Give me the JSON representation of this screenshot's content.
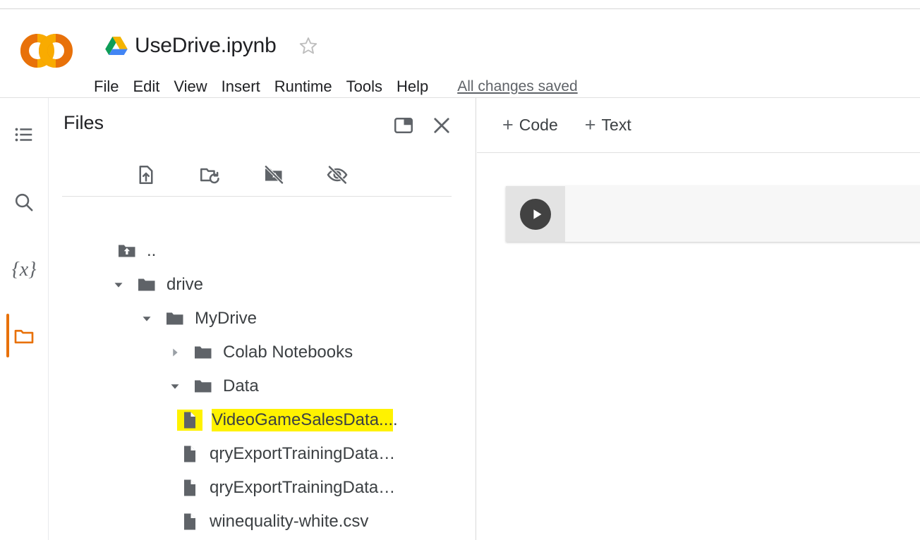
{
  "header": {
    "logo_name": "colab-logo",
    "drive_icon": "google-drive-icon",
    "doc_title": "UseDrive.ipynb",
    "star_icon": "star-outline-icon",
    "menus": [
      "File",
      "Edit",
      "View",
      "Insert",
      "Runtime",
      "Tools",
      "Help"
    ],
    "save_status": "All changes saved"
  },
  "rail": {
    "items": [
      {
        "name": "table-of-contents",
        "icon": "list-icon"
      },
      {
        "name": "find-and-replace",
        "icon": "search-icon"
      },
      {
        "name": "variables",
        "icon": "variables-icon",
        "label": "{x}"
      },
      {
        "name": "files",
        "icon": "folder-icon",
        "active": true
      }
    ]
  },
  "files_panel": {
    "title": "Files",
    "dock_button": "dock-panel-icon",
    "close_button": "close-icon",
    "toolbar": [
      {
        "name": "upload-file",
        "icon": "upload-file-icon"
      },
      {
        "name": "refresh-folder",
        "icon": "refresh-folder-icon"
      },
      {
        "name": "mount-drive-disabled",
        "icon": "drive-off-icon"
      },
      {
        "name": "toggle-hidden-files",
        "icon": "eye-off-icon"
      }
    ],
    "tree": [
      {
        "label": "..",
        "indent": 1,
        "type": "parent",
        "twisty": "none"
      },
      {
        "label": "drive",
        "indent": 0,
        "type": "folder",
        "twisty": "open"
      },
      {
        "label": "MyDrive",
        "indent": 1,
        "type": "folder",
        "twisty": "open"
      },
      {
        "label": "Colab Notebooks",
        "indent": 2,
        "type": "folder",
        "twisty": "closed"
      },
      {
        "label": "Data",
        "indent": 2,
        "type": "folder",
        "twisty": "open"
      },
      {
        "label": "VideoGameSalesData...",
        "tail": ".",
        "indent": 3,
        "type": "file",
        "twisty": "none",
        "highlight": true
      },
      {
        "label": "qryExportTrainingData…",
        "indent": 3,
        "type": "file",
        "twisty": "none"
      },
      {
        "label": "qryExportTrainingData…",
        "indent": 3,
        "type": "file",
        "twisty": "none"
      },
      {
        "label": "winequality-white.csv",
        "indent": 3,
        "type": "file",
        "twisty": "none"
      }
    ],
    "scrollbar": {
      "up_arrow": "scroll-up-arrow-icon",
      "thumb": "scrollbar-thumb"
    }
  },
  "notebook": {
    "add_code_label": "Code",
    "add_text_label": "Text",
    "plus": "+",
    "cell": {
      "run_button": "run-cell-icon"
    }
  },
  "colors": {
    "accent_orange": "#e8710a",
    "highlight_yellow": "#fff200",
    "icon_gray": "#5f6368",
    "text": "#202124"
  }
}
